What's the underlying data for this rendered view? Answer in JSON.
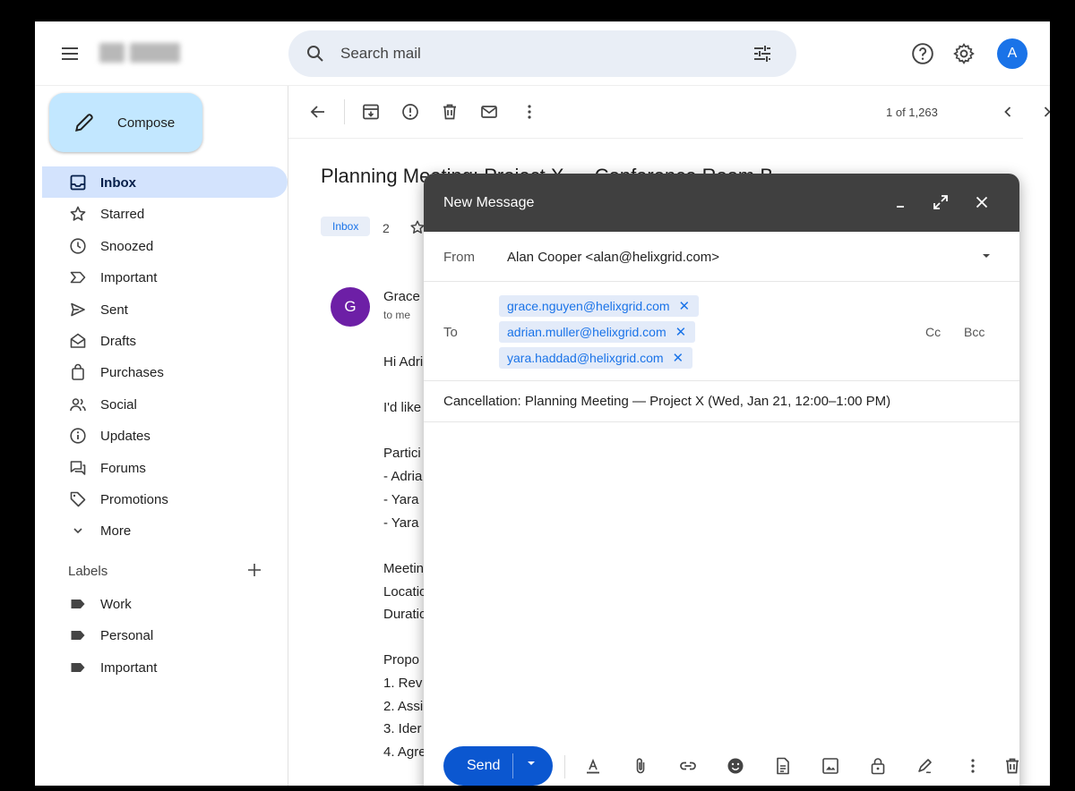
{
  "header": {
    "search_placeholder": "Search mail",
    "avatar_initial": "A"
  },
  "sidebar": {
    "compose_label": "Compose",
    "items": [
      {
        "label": "Inbox",
        "icon": "inbox-icon",
        "active": true
      },
      {
        "label": "Starred",
        "icon": "star-icon"
      },
      {
        "label": "Snoozed",
        "icon": "clock-icon"
      },
      {
        "label": "Important",
        "icon": "important-icon"
      },
      {
        "label": "Sent",
        "icon": "send-icon"
      },
      {
        "label": "Drafts",
        "icon": "draft-icon"
      },
      {
        "label": "Purchases",
        "icon": "shopping-bag-icon"
      },
      {
        "label": "Social",
        "icon": "people-icon"
      },
      {
        "label": "Updates",
        "icon": "info-icon"
      },
      {
        "label": "Forums",
        "icon": "forum-icon"
      },
      {
        "label": "Promotions",
        "icon": "tag-icon"
      },
      {
        "label": "More",
        "icon": "chevron-down-icon"
      }
    ],
    "labels_heading": "Labels",
    "labels": [
      {
        "label": "Work"
      },
      {
        "label": "Personal"
      },
      {
        "label": "Important"
      }
    ]
  },
  "toolbar": {
    "pager": "1 of 1,263"
  },
  "message": {
    "subject": "Planning Meeting: Project X — Conference Room B",
    "tag": "Inbox",
    "thread_count": "2",
    "sender_initial": "G",
    "sender_name": "Grace",
    "sender_to": "to me",
    "body_lines": [
      "Hi Adri",
      "I'd like",
      "Partici",
      "- Adria",
      "- Yara",
      "- Yara",
      "Meetin",
      "Locatio",
      "Duratio",
      "Propo",
      "1. Rev",
      "2. Assi",
      "3. Ider",
      "4. Agre"
    ]
  },
  "compose": {
    "title": "New Message",
    "from_label": "From",
    "from_value": "Alan Cooper <alan@helixgrid.com>",
    "to_label": "To",
    "recipients": [
      "grace.nguyen@helixgrid.com",
      "adrian.muller@helixgrid.com",
      "yara.haddad@helixgrid.com"
    ],
    "remove_glyph": "✕",
    "cc_label": "Cc",
    "bcc_label": "Bcc",
    "subject": "Cancellation: Planning Meeting — Project X (Wed, Jan 21, 12:00–1:00 PM)",
    "send_label": "Send"
  },
  "colors": {
    "accent": "#0b57d0",
    "active_nav": "#d3e3fd",
    "compose_button": "#c2e7ff",
    "dialog_header": "#404040",
    "chip_bg": "#e3ebf9",
    "avatar": "#1a73e8",
    "sender_avatar": "#6d1fa6"
  }
}
